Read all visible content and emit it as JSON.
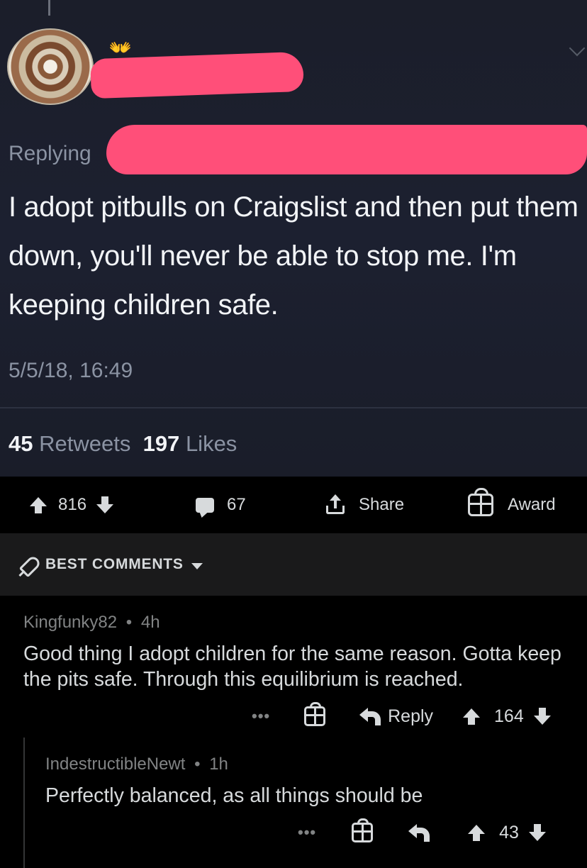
{
  "tweet": {
    "avatar_emoji": "👐",
    "replying_label": "Replying",
    "text": "I adopt pitbulls on Craigslist and then put them down, you'll never be able to stop me. I'm keeping children safe.",
    "timestamp": "5/5/18, 16:49",
    "retweets_count": "45",
    "retweets_label": "Retweets",
    "likes_count": "197",
    "likes_label": "Likes",
    "redaction_color": "#ff4f79"
  },
  "post_actions": {
    "score": "816",
    "comments_count": "67",
    "share_label": "Share",
    "award_label": "Award"
  },
  "sort": {
    "label": "BEST COMMENTS"
  },
  "comments": [
    {
      "author": "Kingfunky82",
      "age": "4h",
      "body": "Good thing I adopt children for the same reason. Gotta keep the pits safe. Through this equilibrium is reached.",
      "more_label": "•••",
      "reply_label": "Reply",
      "score": "164"
    },
    {
      "author": "IndestructibleNewt",
      "age": "1h",
      "body": "Perfectly balanced, as all things should be",
      "more_label": "•••",
      "score": "43"
    }
  ],
  "separator": "•",
  "colors": {
    "background": "#000000",
    "tweet_background": "#1c2030",
    "text_primary": "#d7dadc",
    "text_muted": "#818384",
    "sort_bar": "#1a1a1b"
  }
}
